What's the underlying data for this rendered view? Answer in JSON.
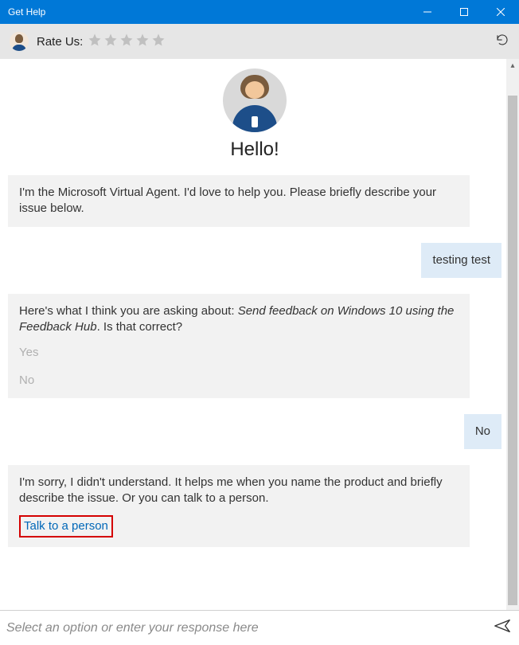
{
  "window": {
    "title": "Get Help"
  },
  "header": {
    "rate_label": "Rate Us:"
  },
  "greeting": {
    "text": "Hello!"
  },
  "messages": {
    "intro": "I'm the Microsoft Virtual Agent. I'd love to help you. Please briefly describe your issue below.",
    "user1": "testing test",
    "clarify_prefix": "Here's what I think you are asking about: ",
    "clarify_topic": "Send feedback on Windows 10 using the Feedback Hub",
    "clarify_suffix": ". Is that correct?",
    "option_yes": "Yes",
    "option_no": "No",
    "user2": "No",
    "sorry": "I'm sorry, I didn't understand. It helps me when you name the product and briefly describe the issue. Or you can talk to a person.",
    "talk_link": "Talk to a person"
  },
  "input": {
    "placeholder": "Select an option or enter your response here"
  }
}
